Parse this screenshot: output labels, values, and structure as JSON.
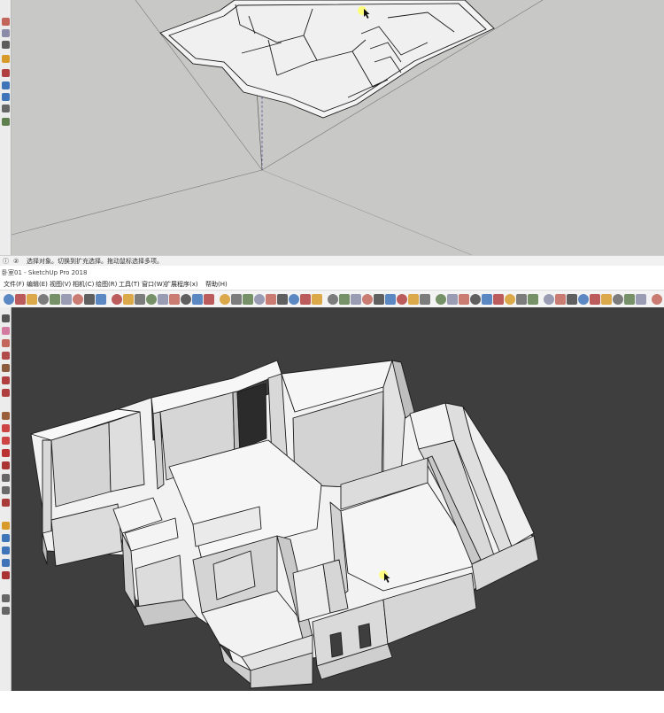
{
  "top_window": {
    "status_text": "选择对象。切换到扩充选择。拖动鼠标选择多项。",
    "status_icons": [
      "info-icon",
      "help-icon"
    ]
  },
  "bottom_window": {
    "title": "卧室01 - SketchUp Pro 2018",
    "menu": [
      "文件(F)",
      "编辑(E)",
      "视图(V)",
      "相机(C)",
      "绘图(R)",
      "工具(T)",
      "窗口(W)",
      "扩展程序(x)",
      "帮助(H)"
    ],
    "toolbar_icons": [
      "select-icon",
      "eraser-icon",
      "paint-bucket-icon",
      "line-icon",
      "move-icon",
      "rotate-icon",
      "push-pull-icon",
      "offset-icon",
      "tape-measure-icon",
      "orbit-icon",
      "pan-icon",
      "zoom-icon",
      "zoom-extents-icon",
      "iso-view-icon",
      "top-view-icon",
      "front-view-icon",
      "right-view-icon",
      "back-view-icon",
      "left-view-icon",
      "xray-icon",
      "wireframe-icon",
      "hidden-line-icon",
      "shaded-icon",
      "textured-icon",
      "monochrome-icon",
      "component-icon",
      "warehouse-icon",
      "extension-icon",
      "section-plane-icon",
      "section-display-icon",
      "house-icon",
      "house-outline-icon",
      "shadow-icon",
      "fog-icon",
      "layer-icon",
      "scene-icon",
      "style-icon",
      "outliner-icon",
      "ruby-icon",
      "sandbox-icon",
      "solid-tools-icon",
      "follow-me-icon",
      "arc-icon",
      "circle-icon",
      "polygon-icon",
      "rectangle-icon",
      "freehand-icon",
      "text-icon",
      "dimension-icon",
      "protractor-icon",
      "axes-icon",
      "3d-text-icon",
      "position-camera-icon",
      "walk-icon",
      "look-around-icon",
      "flip-icon",
      "scale-icon",
      "intersect-icon",
      "union-icon",
      "subtract-icon",
      "trim-icon",
      "split-icon",
      "outer-shell-icon",
      "curve-icon",
      "bezier-icon",
      "spline-icon",
      "label-icon",
      "settings-icon"
    ]
  },
  "colors": {
    "top_background": "#c8c8c6",
    "bottom_background": "#3e3e3e",
    "model_face": "#f5f5f5",
    "model_wall_side": "#d3d3d3",
    "edge": "#1a1a1a",
    "cursor_highlight": "#ffff66"
  }
}
